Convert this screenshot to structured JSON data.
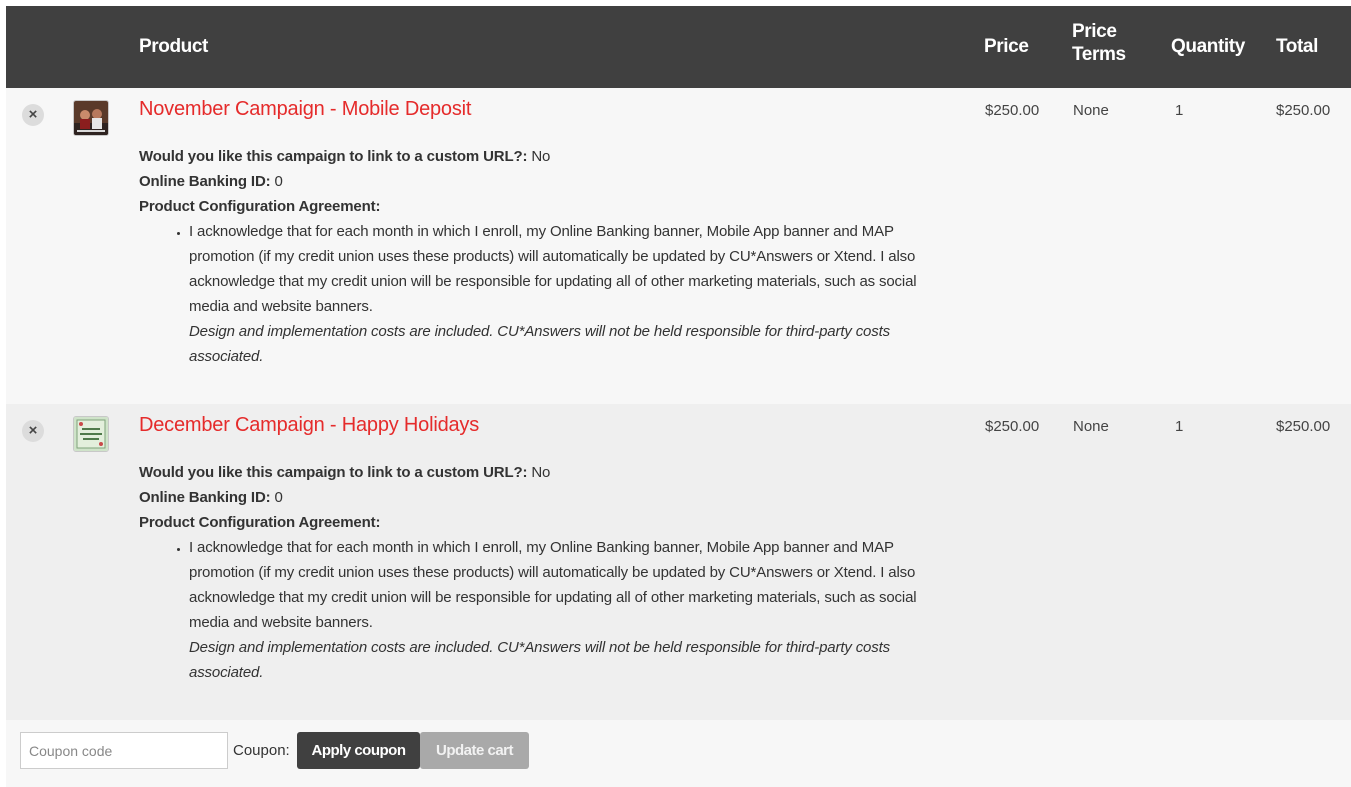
{
  "header": {
    "product": "Product",
    "price": "Price",
    "price_terms_line1": "Price",
    "price_terms_line2": "Terms",
    "quantity": "Quantity",
    "total": "Total"
  },
  "items": [
    {
      "remove_glyph": "×",
      "name": "November Campaign - Mobile Deposit",
      "custom_url_label": "Would you like this campaign to link to a custom URL?:",
      "custom_url_value": " No",
      "banking_label": "Online Banking ID:",
      "banking_value": " 0",
      "agreement_label": "Product Configuration Agreement:",
      "agreement_text": "I acknowledge that for each month in which I enroll, my Online Banking banner, Mobile App banner and MAP promotion (if my credit union uses these products) will automatically be updated by CU*Answers or Xtend. I also acknowledge that my credit union will be responsible for updating all of other marketing materials, such as social media and website banners.",
      "agreement_note": "Design and implementation costs are included. CU*Answers will not be held responsible for third-party costs associated.",
      "price": "$250.00",
      "terms": "None",
      "quantity": "1",
      "total": "$250.00",
      "thumb_icon": "campaign-thumbnail"
    },
    {
      "remove_glyph": "×",
      "name": "December Campaign - Happy Holidays",
      "custom_url_label": "Would you like this campaign to link to a custom URL?:",
      "custom_url_value": " No",
      "banking_label": "Online Banking ID:",
      "banking_value": " 0",
      "agreement_label": "Product Configuration Agreement:",
      "agreement_text": "I acknowledge that for each month in which I enroll, my Online Banking banner, Mobile App banner and MAP promotion (if my credit union uses these products) will automatically be updated by CU*Answers or Xtend. I also acknowledge that my credit union will be responsible for updating all of other marketing materials, such as social media and website banners.",
      "agreement_note": "Design and implementation costs are included. CU*Answers will not be held responsible for third-party costs associated.",
      "price": "$250.00",
      "terms": "None",
      "quantity": "1",
      "total": "$250.00",
      "thumb_icon": "holiday-thumbnail"
    }
  ],
  "coupon": {
    "placeholder": "Coupon code",
    "label": "Coupon:",
    "apply": "Apply coupon",
    "update": "Update cart"
  },
  "colors": {
    "header_bg": "#404040",
    "product_link": "#e52b2b",
    "apply_button": "#404040",
    "update_button_disabled": "#a9a9a9"
  }
}
